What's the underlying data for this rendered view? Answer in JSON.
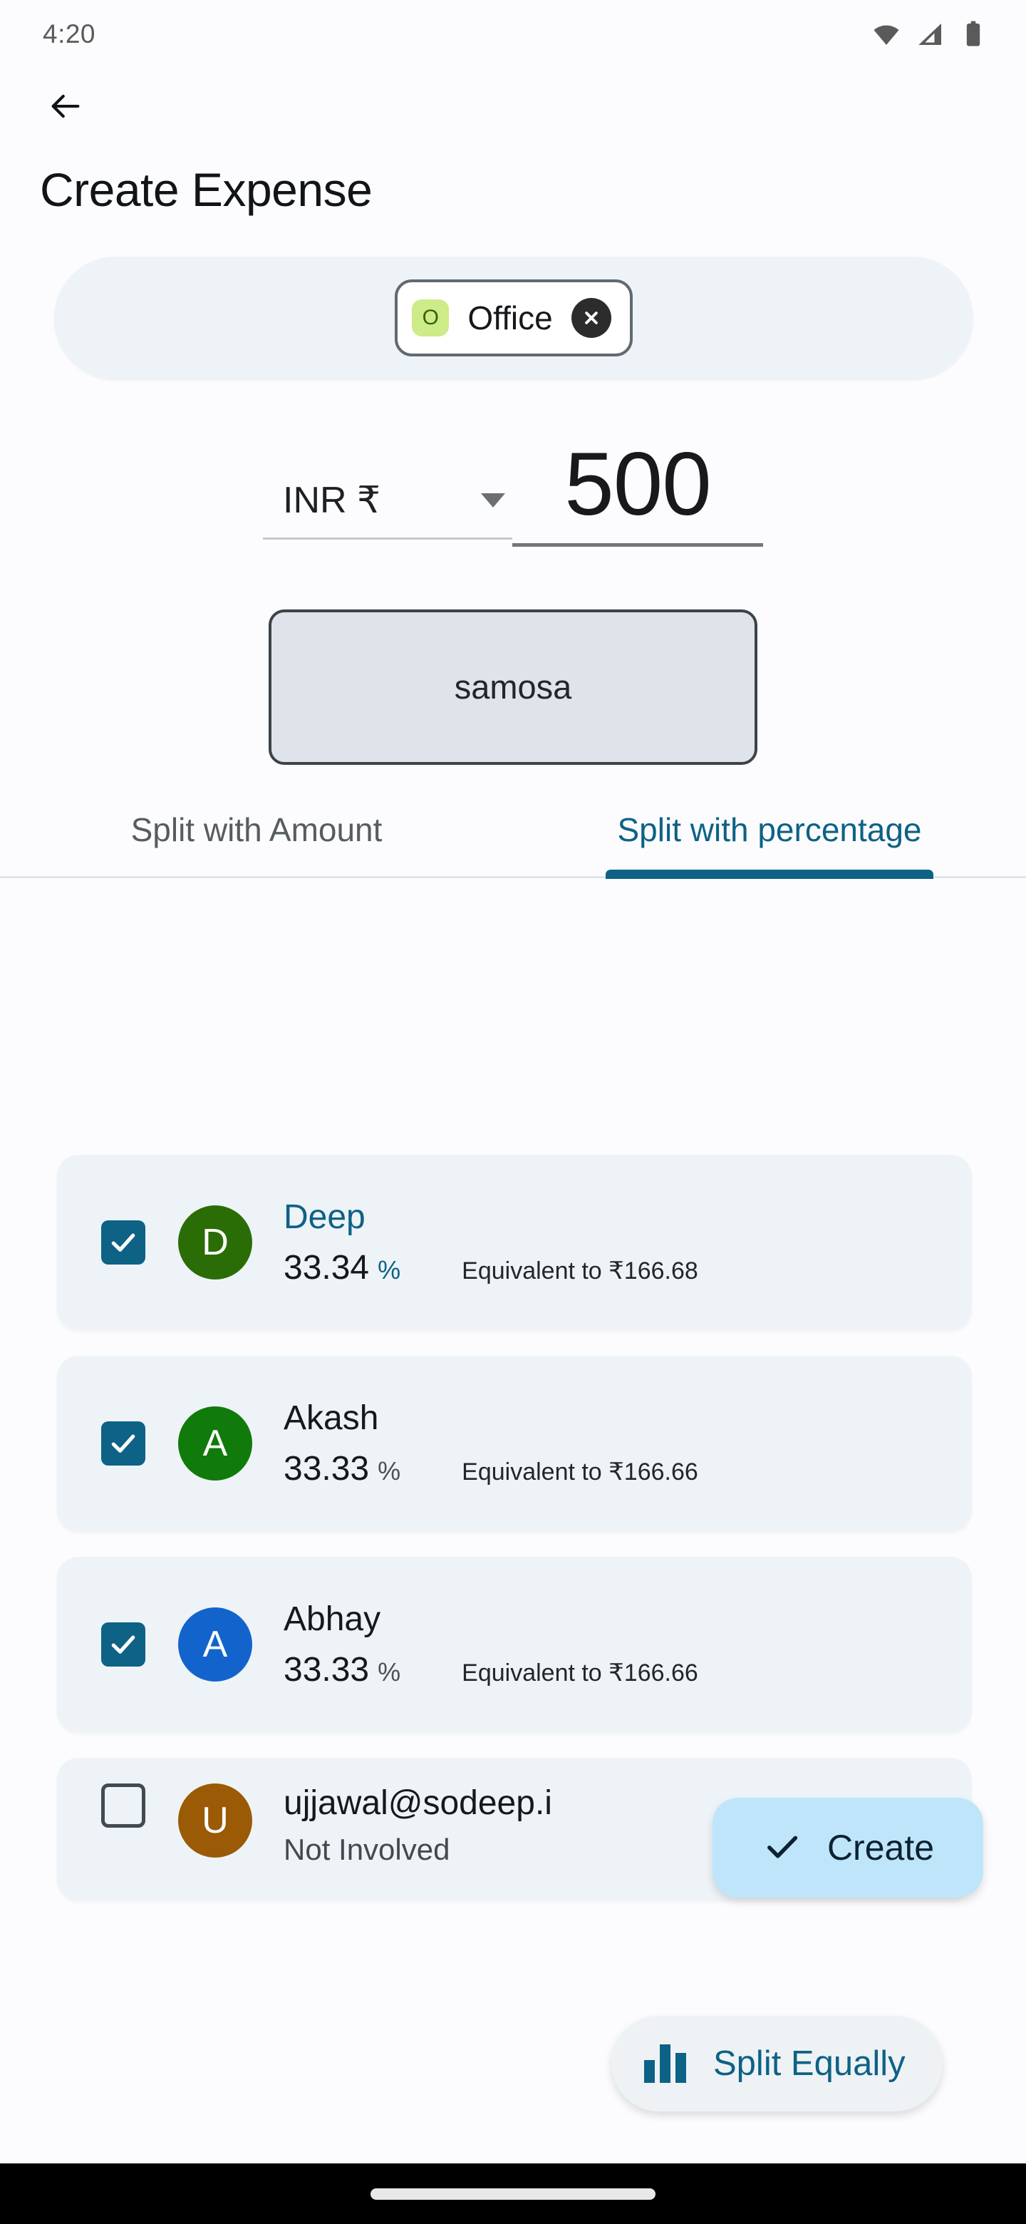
{
  "status_bar": {
    "time": "4:20",
    "icons": [
      "wifi-icon",
      "cellular-signal-icon",
      "battery-icon"
    ]
  },
  "app_bar": {
    "back_icon": "back-arrow-icon",
    "title": "Create Expense"
  },
  "group_field": {
    "chip": {
      "avatar_initial": "O",
      "avatar_color": "#cdeb87",
      "label": "Office",
      "remove_icon": "close-circle-icon"
    }
  },
  "amount_section": {
    "currency_label": "INR ₹",
    "currency_dropdown_icon": "chevron-down-icon",
    "amount_value": "500"
  },
  "description": {
    "value": "samosa"
  },
  "tabs": [
    {
      "label": "Split with Amount",
      "active": false
    },
    {
      "label": "Split with percentage",
      "active": true
    }
  ],
  "people": [
    {
      "checked": true,
      "avatar_initial": "D",
      "avatar_color": "#2a6d06",
      "name": "Deep",
      "name_highlighted": true,
      "percent": "33.34",
      "percent_symbol": "%",
      "equivalent": "Equivalent to ₹166.68"
    },
    {
      "checked": true,
      "avatar_initial": "A",
      "avatar_color": "#107a0a",
      "name": "Akash",
      "name_highlighted": false,
      "percent": "33.33",
      "percent_symbol": "%",
      "equivalent": "Equivalent to ₹166.66"
    },
    {
      "checked": true,
      "avatar_initial": "A",
      "avatar_color": "#1264cc",
      "name": "Abhay",
      "name_highlighted": false,
      "percent": "33.33",
      "percent_symbol": "%",
      "equivalent": "Equivalent to ₹166.66"
    },
    {
      "checked": false,
      "avatar_initial": "U",
      "avatar_color": "#9a5a06",
      "name": "ujjawal@sodeep.i",
      "name_highlighted": false,
      "subtitle": "Not Involved"
    }
  ],
  "create_button": {
    "icon": "check-icon",
    "label": "Create",
    "color": "#bfe5fb"
  },
  "split_equally_button": {
    "icon": "bar-chart-icon",
    "label": "Split Equally",
    "color": "#0d6285"
  },
  "colors": {
    "accent": "#0d6285",
    "card_background": "#eef3f7",
    "page_background": "#fcfcfe"
  }
}
